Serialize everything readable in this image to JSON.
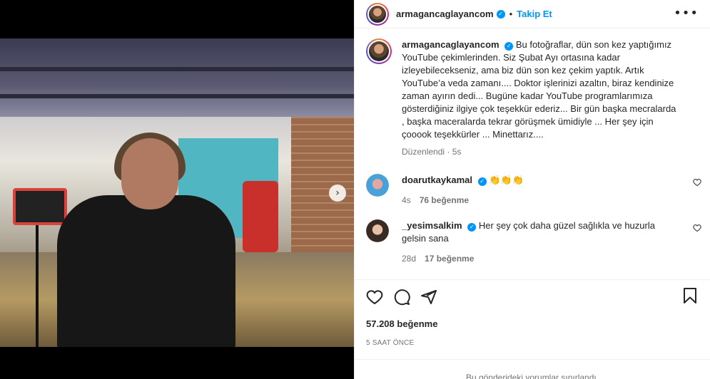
{
  "post": {
    "username": "armagancaglayancom",
    "follow_label": "Takip Et",
    "separator": "•",
    "more_label": "•••",
    "next_label": "›"
  },
  "caption": {
    "username": "armagancaglayancom",
    "text": "Bu fotoğraflar, dün son kez yaptığımız YouTube çekimlerinden. Siz Şubat Ayı ortasına kadar izleyebilecekseniz, ama biz dün son kez çekim yaptık. Artık YouTube’a veda zamanı.... Doktor işlerinizi azaltın, biraz kendinize zaman ayırın dedi... Bugüne kadar YouTube programlarımıza gösterdiğiniz ilgiye çok teşekkür ederiz... Bir gün başka mecralarda , başka maceralarda tekrar görüşmek ümidiyle ... Her şey için çooook teşekkürler ... Minettarız....",
    "edited": "Düzenlendi",
    "dot": "·",
    "age": "5s"
  },
  "comments": [
    {
      "username": "doarutkaykamal",
      "text": "👏👏👏",
      "age": "4s",
      "likes": "76 beğenme"
    },
    {
      "username": "_yesimsalkim",
      "text": "Her şey çok daha güzel sağlıkla ve huzurla gelsin sana",
      "age": "28d",
      "likes": "17 beğenme"
    }
  ],
  "stats": {
    "likes": "57.208 beğenme",
    "time": "5 SAAT ÖNCE"
  },
  "footer": {
    "text": "Bu gönderideki yorumlar sınırlandı."
  },
  "carousel": {
    "count": 2,
    "active": 1
  },
  "colors": {
    "accent": "#0095f6",
    "text": "#262626",
    "muted": "#737373"
  }
}
